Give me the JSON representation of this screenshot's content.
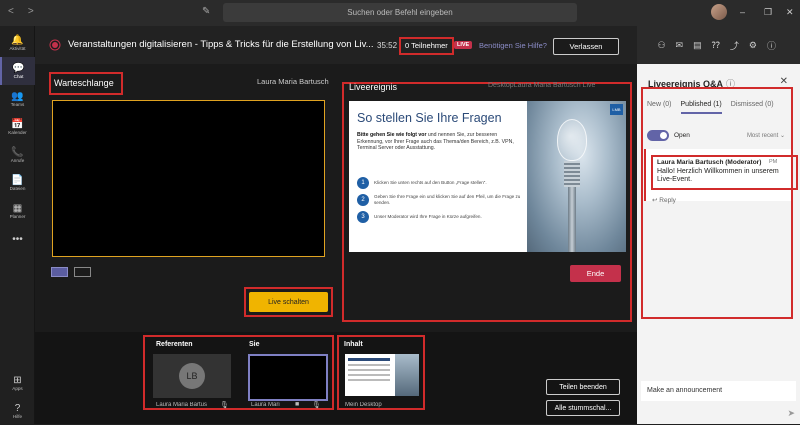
{
  "search": {
    "placeholder": "Suchen oder Befehl eingeben"
  },
  "rail": [
    {
      "label": "Aktivität",
      "icon": "bell-icon",
      "glyph": "🔔"
    },
    {
      "label": "Chat",
      "icon": "chat-icon",
      "glyph": "💬"
    },
    {
      "label": "Teams",
      "icon": "teams-icon",
      "glyph": "👥"
    },
    {
      "label": "Kalender",
      "icon": "calendar-icon",
      "glyph": "📅"
    },
    {
      "label": "Anrufe",
      "icon": "phone-icon",
      "glyph": "📞"
    },
    {
      "label": "Dateien",
      "icon": "files-icon",
      "glyph": "📄"
    },
    {
      "label": "Planner",
      "icon": "planner-icon",
      "glyph": "▦"
    },
    {
      "label": "",
      "icon": "more-icon",
      "glyph": "•••"
    },
    {
      "label": "Apps",
      "icon": "apps-icon",
      "glyph": "⊞"
    },
    {
      "label": "Hilfe",
      "icon": "help-icon",
      "glyph": "?"
    }
  ],
  "header": {
    "title": "Veranstaltungen digitalisieren - Tipps & Tricks für die Erstellung von Liv...",
    "timer": "35:52",
    "participants": "0 Teilnehmer",
    "live": "LIVE",
    "help": "Benötigen Sie Hilfe?",
    "leave": "Verlassen"
  },
  "queue": {
    "label": "Warteschlange",
    "presenter": "Laura Maria Bartusch",
    "go_live": "Live schalten"
  },
  "live_event": {
    "label": "Liveereignis",
    "sub": "DesktopLaura Maria Bartusch Live",
    "end": "Ende",
    "slide": {
      "title": "So stellen Sie Ihre Fragen",
      "body_bold": "Bitte gehen Sie wie folgt vor",
      "body": " und nennen Sie, zur besseren Erkennung, vor Ihrer Frage auch das Thema/den Bereich, z.B. VPN, Terminal Server oder Ausstattung.",
      "logo": "LMB",
      "steps": [
        {
          "n": "1",
          "text": "Klicken Sie unten rechts auf den Button „Frage stellen“."
        },
        {
          "n": "2",
          "text": "Geben Sie Ihre Frage ein und klicken Sie auf den Pfeil, um die Frage zu senden."
        },
        {
          "n": "3",
          "text": "Unser Moderator wird Ihre Frage in Kürze aufgreifen."
        }
      ]
    }
  },
  "bottom": {
    "referenten": "Referenten",
    "sie": "Sie",
    "inhalt": "Inhalt",
    "initials": "LB",
    "ref_name": "Laura Maria Bartus",
    "you_name": "Laura Mari",
    "inhalt_name": "Mein Desktop",
    "stop_share": "Teilen beenden",
    "mute_all": "Alle stummschal..."
  },
  "qa": {
    "title": "Liveereignis Q&A",
    "tabs": [
      "New (0)",
      "Published (1)",
      "Dismissed (0)"
    ],
    "open": "Open",
    "sort": "Most recent",
    "author": "Laura Maria Bartusch (Moderator)",
    "time": "PM",
    "message": "Hallo! Herzlich Willkommen in unserem Live-Event.",
    "reply": "Reply",
    "announce": "Make an announcement"
  }
}
